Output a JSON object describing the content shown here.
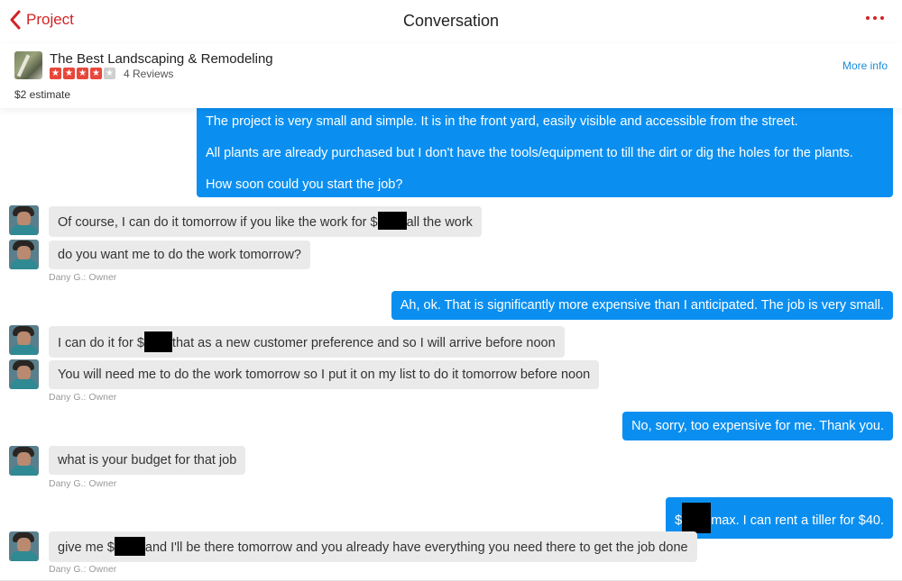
{
  "nav": {
    "back_label": "Project",
    "title": "Conversation"
  },
  "business": {
    "name": "The Best Landscaping & Remodeling",
    "rating": 4,
    "rating_max": 5,
    "reviews": "4 Reviews",
    "estimate": "$2 estimate",
    "more_info": "More info"
  },
  "messages": {
    "m1": {
      "p1": "The project is very small and simple. It is in the front yard, easily visible and accessible from the street.",
      "p2": "All plants are already purchased but I don't have the tools/equipment to till the dirt or dig the holes for the plants.",
      "p3": "How soon could you start the job?"
    },
    "m2": {
      "before": "Of course, I can do it tomorrow if you like the work for $",
      "after": "all the work"
    },
    "m3": {
      "text": "do you want me to do the work tomorrow?"
    },
    "s1": "Dany G.: Owner",
    "m4": {
      "text": "Ah, ok. That is significantly more expensive than I anticipated. The job is very small."
    },
    "m5": {
      "before": "I can do it for $",
      "after": "that as a new customer preference and so I will arrive before noon"
    },
    "m6": {
      "text": "You will need me to do the work tomorrow so I put it on my list to do it tomorrow before noon"
    },
    "s2": "Dany G.: Owner",
    "m7": {
      "text": "No, sorry, too expensive for me. Thank you."
    },
    "m8": {
      "text": "what is your budget for that job"
    },
    "s3": "Dany G.: Owner",
    "m9": {
      "before": "$",
      "after": "max. I can rent a tiller for $40."
    },
    "m10": {
      "before": "give me $",
      "after": "and I'll be there tomorrow and you already have everything you need there to get the job done"
    },
    "s4": "Dany G.: Owner"
  },
  "colors": {
    "accent_red": "#d32323",
    "outgoing_bubble": "#0a8ff0",
    "incoming_bubble": "#eaeaea",
    "link_blue": "#1a8cd8"
  },
  "icons": {
    "back": "chevron-left-icon",
    "more": "more-dots-icon"
  }
}
